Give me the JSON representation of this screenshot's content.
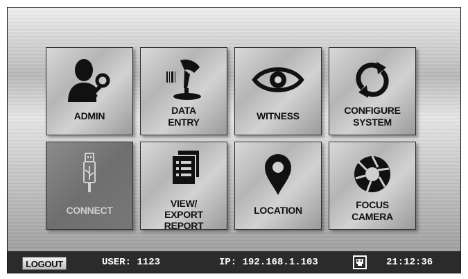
{
  "tiles": [
    {
      "label": "ADMIN",
      "icon": "admin-user-key-icon"
    },
    {
      "label": "DATA\nENTRY",
      "icon": "barcode-scanner-icon"
    },
    {
      "label": "WITNESS",
      "icon": "eye-icon"
    },
    {
      "label": "CONFIGURE\nSYSTEM",
      "icon": "refresh-arrows-icon"
    },
    {
      "label": "CONNECT",
      "icon": "usb-icon",
      "disabled": true
    },
    {
      "label": "VIEW/\nEXPORT\nREPORT",
      "icon": "report-pages-icon"
    },
    {
      "label": "LOCATION",
      "icon": "map-pin-icon"
    },
    {
      "label": "FOCUS\nCAMERA",
      "icon": "camera-aperture-icon"
    }
  ],
  "status_bar": {
    "logout_label": "LOGOUT",
    "user": "USER: 1123",
    "ip": "IP: 192.168.1.103",
    "network_icon": "ethernet-port-icon",
    "time": "21:12:36"
  },
  "colors": {
    "status_bar_bg": "#2b2b2b",
    "tile_text": "#111111",
    "disabled_text": "#cfcfcf"
  }
}
